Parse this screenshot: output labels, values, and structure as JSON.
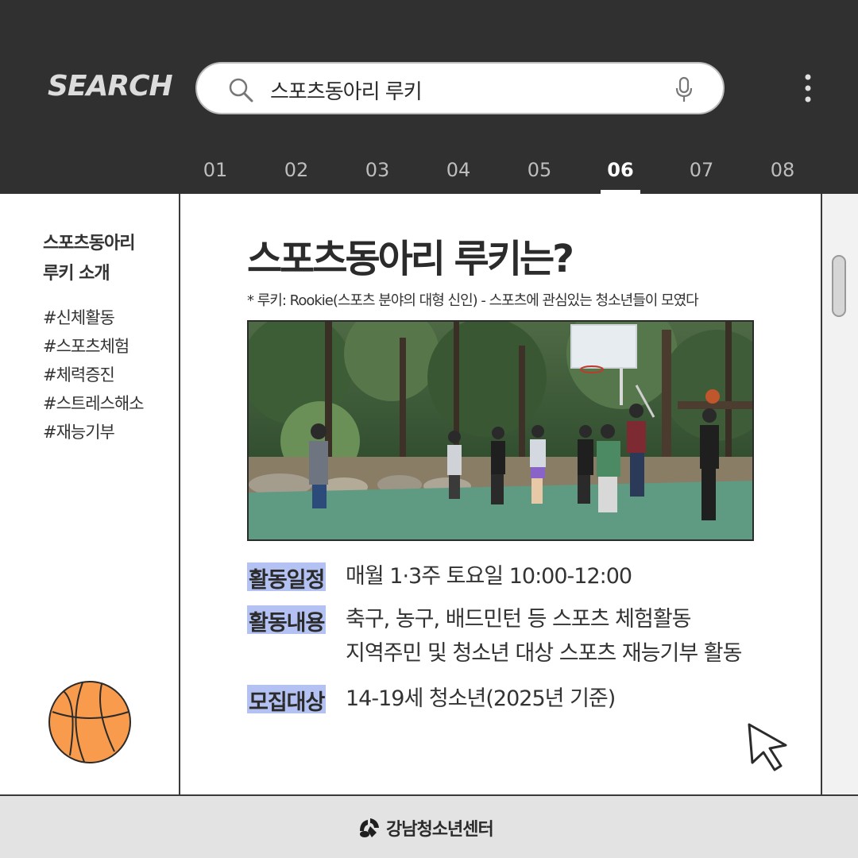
{
  "header": {
    "brand": "SEARCH",
    "search": {
      "query": "스포츠동아리 루키"
    },
    "icons": [
      "search-icon",
      "mic-icon",
      "more-vertical-icon"
    ],
    "tabs": [
      {
        "label": "01"
      },
      {
        "label": "02"
      },
      {
        "label": "03"
      },
      {
        "label": "04"
      },
      {
        "label": "05"
      },
      {
        "label": "06",
        "active": true
      },
      {
        "label": "07"
      },
      {
        "label": "08"
      }
    ]
  },
  "sidebar": {
    "title_line1": "스포츠동아리",
    "title_line2": "루키 소개",
    "tags": [
      "#신체활동",
      "#스포츠체험",
      "#체력증진",
      "#스트레스해소",
      "#재능기부"
    ],
    "icon": "basketball-icon"
  },
  "main": {
    "title": "스포츠동아리 루키는?",
    "subtitle": "* 루키: Rookie(스포츠 분야의 대형 신인) - 스포츠에 관심있는 청소년들이 모였다",
    "photo": "basketball-court-photo",
    "info": [
      {
        "label": "활동일정",
        "lines": [
          "매월 1·3주 토요일 10:00-12:00"
        ]
      },
      {
        "label": "활동내용",
        "lines": [
          "축구, 농구, 배드민턴 등 스포츠 체험활동",
          "지역주민 및 청소년 대상 스포츠 재능기부 활동"
        ]
      },
      {
        "label": "모집대상",
        "lines": [
          "14-19세 청소년(2025년 기준)"
        ]
      }
    ]
  },
  "footer": {
    "org_name": "강남청소년센터"
  },
  "colors": {
    "header_bg": "#303030",
    "label_highlight": "#b3c2f2",
    "basketball": "#f99b4c",
    "footer_bg": "#e3e3e3"
  }
}
